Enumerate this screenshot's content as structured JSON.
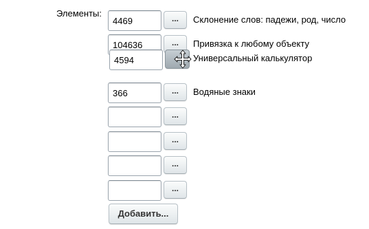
{
  "form": {
    "label": "Элементы:",
    "browse_label": "...",
    "add_label": "Добавить..."
  },
  "rows": [
    {
      "value": "4469",
      "name": "Склонение слов: падежи, род, число"
    },
    {
      "value": "104636",
      "name": "Привязка к любому объекту"
    },
    {
      "value": "366",
      "name": "Водяные знаки"
    },
    {
      "value": "",
      "name": ""
    },
    {
      "value": "",
      "name": ""
    },
    {
      "value": "",
      "name": ""
    },
    {
      "value": "",
      "name": ""
    }
  ],
  "dragged_row": {
    "value": "4594",
    "name": "Универсальный калькулятор"
  },
  "icons": {
    "drag_cursor": "move-cursor-icon"
  }
}
